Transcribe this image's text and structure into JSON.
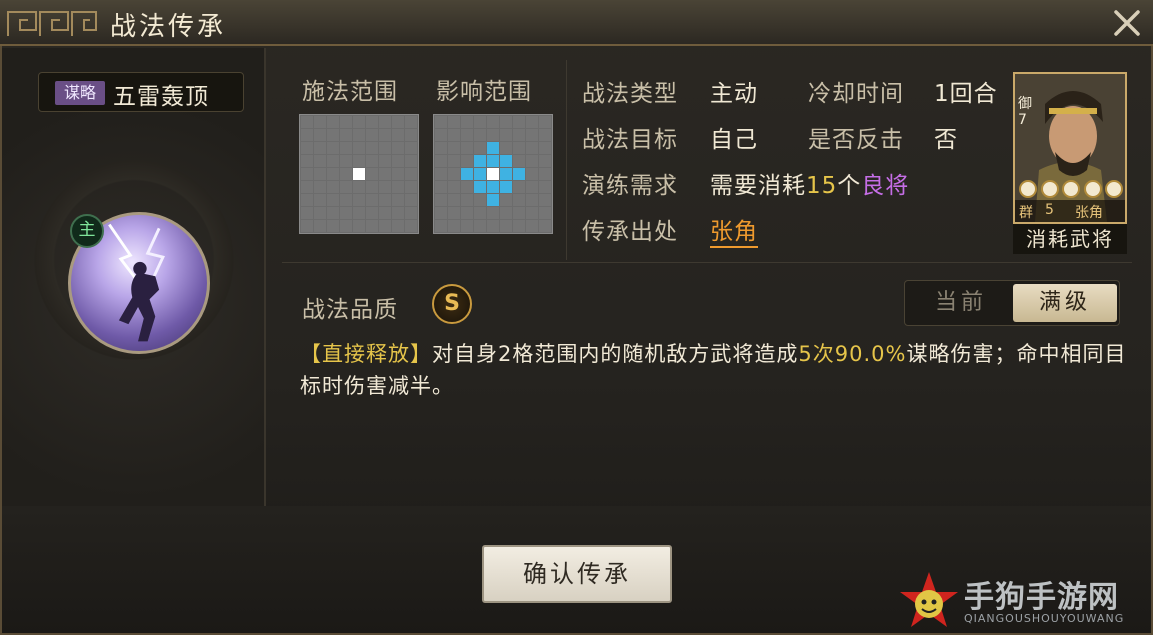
{
  "window": {
    "title": "战法传承"
  },
  "skill": {
    "tag": "谋略",
    "name": "五雷轰顶",
    "main_badge": "主"
  },
  "ranges": {
    "cast_label": "施法范围",
    "effect_label": "影响范围"
  },
  "fields": {
    "type_label": "战法类型",
    "type_value": "主动",
    "cooldown_label": "冷却时间",
    "cooldown_value": "1回合",
    "target_label": "战法目标",
    "target_value": "自己",
    "counter_label": "是否反击",
    "counter_value": "否",
    "drill_label": "演练需求",
    "drill_prefix": "需要消耗",
    "drill_count": "15",
    "drill_unit": "个",
    "drill_grade": "良将",
    "source_label": "传承出处",
    "source_value": "张角"
  },
  "general_card": {
    "tag": "御7",
    "faction": "群",
    "level": "5",
    "name": "张角",
    "caption": "消耗武将"
  },
  "quality": {
    "label": "战法品质",
    "grade": "S",
    "toggle_current": "当前",
    "toggle_max": "满级"
  },
  "description": {
    "bracket": "【直接释放】",
    "p1": "对自身2格范围内的随机敌方武将造成",
    "times": "5次",
    "percent": "90.0%",
    "p2": "谋略伤害；命中相同目标时伤害减半。"
  },
  "footer": {
    "confirm": "确认传承"
  },
  "watermark": {
    "text": "手狗手游网",
    "sub": "QIANGOUSHOUYOUWANG"
  },
  "colors": {
    "accent": "#e6c54a",
    "range_highlight": "#3fb2e2",
    "grade_purple": "#c56ee6",
    "link_orange": "#ef9a2e"
  },
  "icons": {
    "close": "close-icon",
    "ornament": "title-ornament-icon"
  }
}
